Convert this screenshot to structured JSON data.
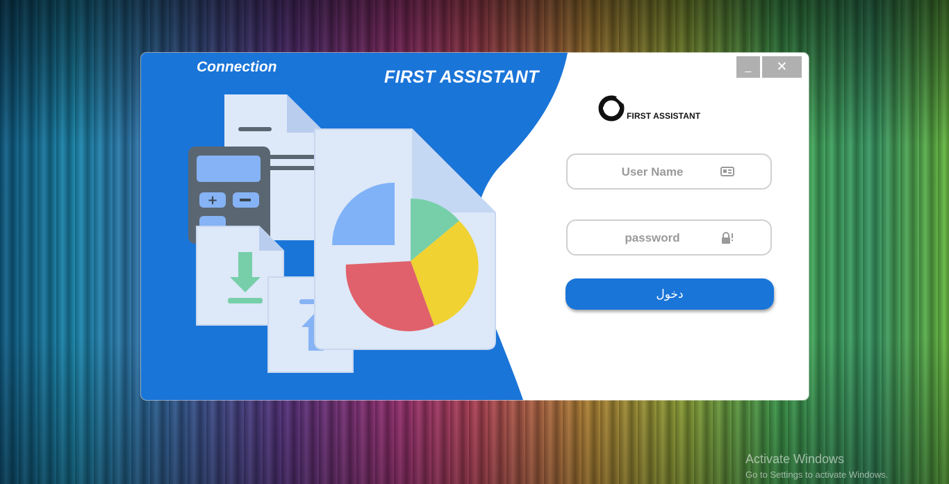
{
  "window": {
    "connection_label": "Connection",
    "brand_title": "FIRST ASSISTANT",
    "minimize_label": "_",
    "close_label": "✕"
  },
  "logo": {
    "text": "FIRST ASSISTANT"
  },
  "form": {
    "username_placeholder": "User Name",
    "password_placeholder": "password",
    "submit_label": "دخول"
  },
  "colors": {
    "panel_blue": "#1a75d8",
    "button_gray": "#b0b0b0",
    "field_border": "#d0d0d0"
  },
  "icons": [
    "id-card-icon",
    "lock-icon",
    "logo-ring-icon",
    "calculator-icon",
    "document-icon",
    "pie-chart-icon",
    "download-icon",
    "upload-icon"
  ],
  "watermark": {
    "title": "Activate Windows",
    "subtitle": "Go to Settings to activate Windows."
  }
}
